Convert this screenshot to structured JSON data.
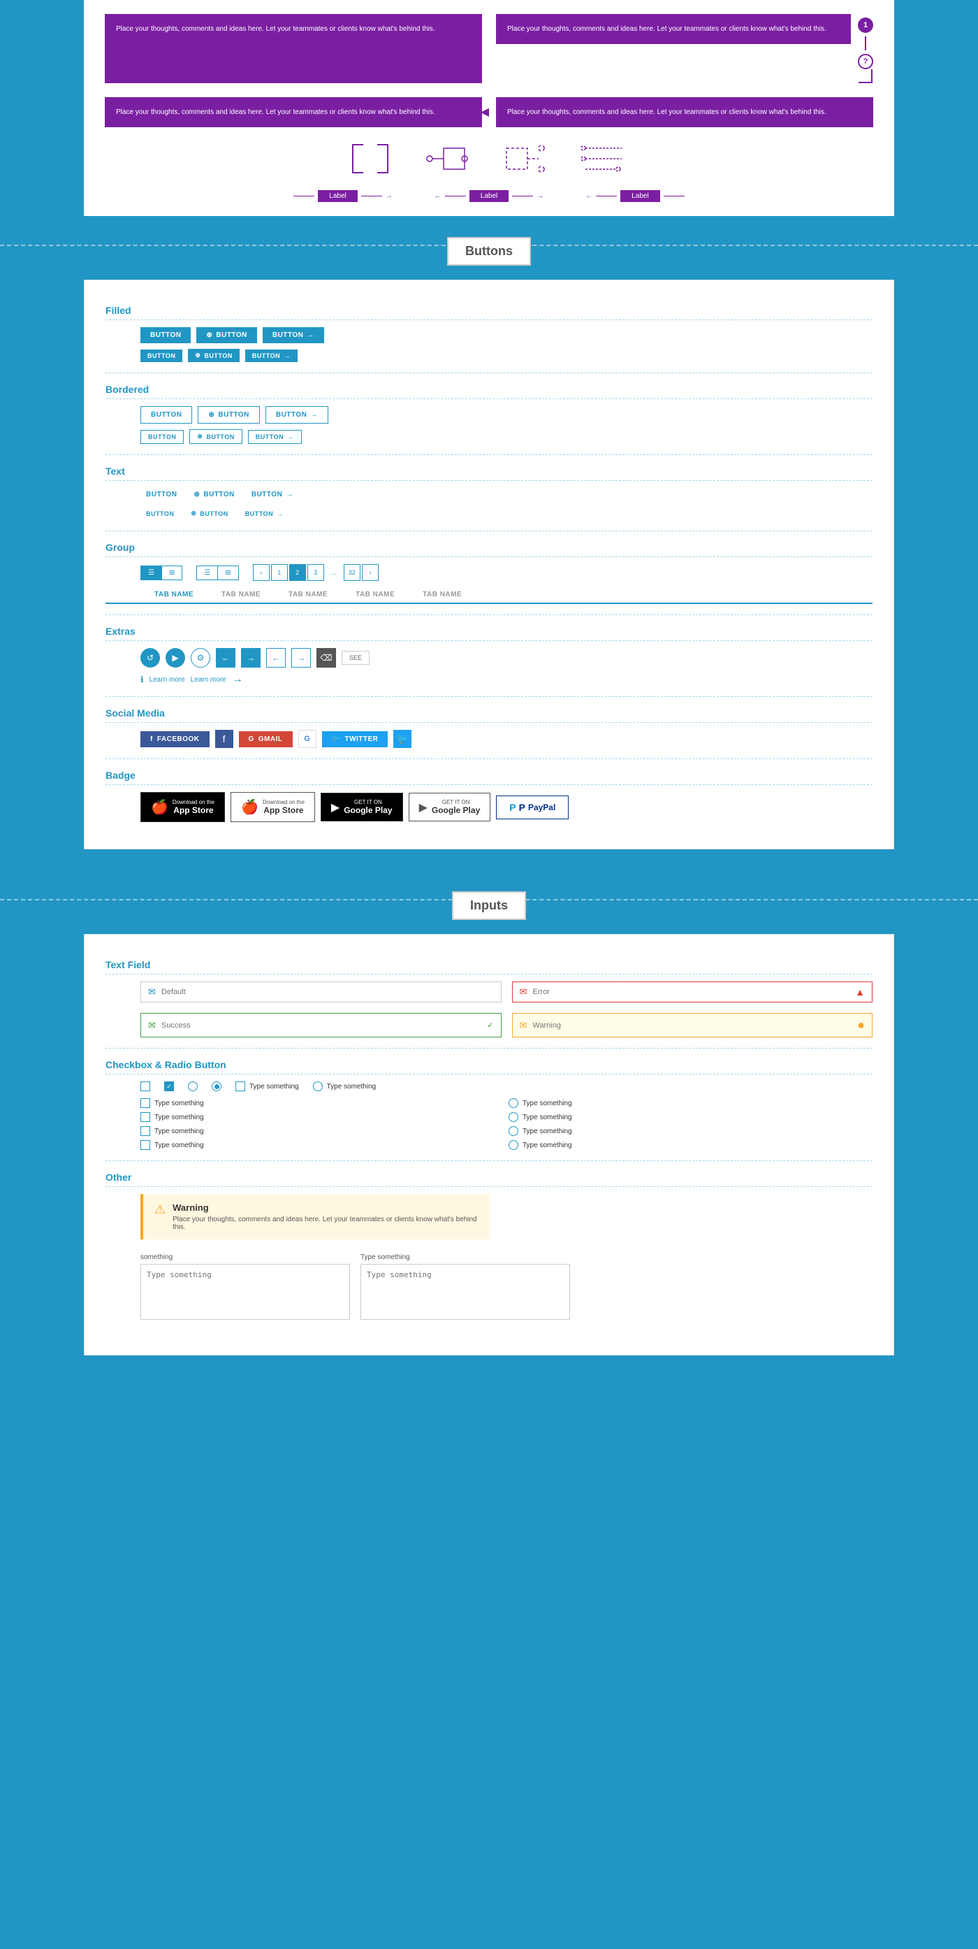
{
  "sections": {
    "buttons_label": "Buttons",
    "inputs_label": "Inputs"
  },
  "top_callouts": [
    {
      "text": "Place your thoughts, comments and ideas here. Let your teammates or clients know what's behind this."
    },
    {
      "text": "Place your thoughts, comments and ideas here. Let your teammates or clients know what's behind this."
    },
    {
      "text": "Place your thoughts, comments and ideas here. Let your teammates or clients know what's behind this."
    },
    {
      "text": "Place your thoughts, comments and ideas here. Let your teammates or clients know what's behind this."
    }
  ],
  "buttons": {
    "filled_label": "Filled",
    "bordered_label": "Bordered",
    "text_label": "Text",
    "group_label": "Group",
    "extras_label": "Extras",
    "social_label": "Social Media",
    "badge_label": "Badge",
    "button_text": "BUTTON",
    "tab_names": [
      "TAB NAME",
      "TAB NAME",
      "TAB NAME",
      "TAB NAME",
      "TAB NAME"
    ],
    "learn_more": "Learn more",
    "facebook": "FACEBOOK",
    "gmail": "GMAIL",
    "twitter": "TWITTER",
    "app_store_1": "App Store",
    "app_store_sub_1": "Download on the",
    "app_store_2": "App Store",
    "app_store_sub_2": "Download on the",
    "google_play_1": "Google Play",
    "google_play_sub_1": "GET IT ON",
    "google_play_2": "Google Play",
    "google_play_sub_2": "GET IT ON",
    "paypal": "PayPal",
    "page_numbers": [
      "1",
      "2",
      "3",
      "32"
    ]
  },
  "inputs": {
    "text_field_label": "Text Field",
    "checkbox_label": "Checkbox & Radio Button",
    "other_label": "Other",
    "default_placeholder": "Default",
    "error_placeholder": "Error",
    "success_placeholder": "Success",
    "warning_placeholder": "Warning",
    "type_something": "Type something",
    "something": "something",
    "warning_title": "Warning",
    "warning_text": "Place your thoughts, comments and ideas here. Let your teammates or clients know what's behind this.",
    "textarea_placeholder": "Type something"
  }
}
